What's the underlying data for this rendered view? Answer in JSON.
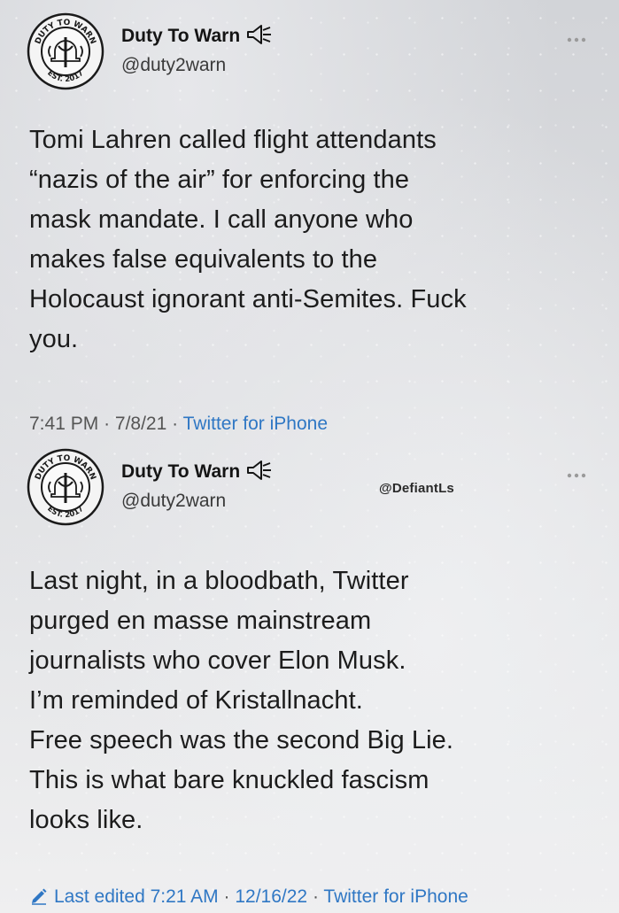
{
  "tweets": [
    {
      "author": {
        "display_name": "Duty To Warn",
        "handle": "@duty2warn",
        "logo_text_top": "DUTY TO WARN",
        "logo_text_bottom": "EST. 2017",
        "icons": [
          "logo-seal-icon",
          "speaker-icon",
          "more-options-icon"
        ]
      },
      "text_lines": [
        "Tomi Lahren called flight attendants",
        "“nazis of the air” for enforcing the",
        "mask mandate. I call anyone who",
        "makes false equivalents to the",
        "Holocaust ignorant anti-Semites. Fuck",
        "you."
      ],
      "meta": {
        "time": "7:41 PM",
        "date": "7/8/21",
        "separator": "·",
        "source": "Twitter for iPhone"
      }
    },
    {
      "author": {
        "display_name": "Duty To Warn",
        "handle": "@duty2warn",
        "logo_text_top": "DUTY TO WARN",
        "logo_text_bottom": "EST. 2017",
        "icons": [
          "logo-seal-icon",
          "speaker-icon",
          "more-options-icon"
        ]
      },
      "watermark": "@DefiantLs",
      "text_lines": [
        "Last night, in a bloodbath, Twitter",
        "purged en masse mainstream",
        "journalists who cover Elon Musk.",
        "I’m reminded of Kristallnacht.",
        "Free speech was the second Big Lie.",
        "This is what bare knuckled fascism",
        "looks like."
      ],
      "meta": {
        "edited_label": "Last edited",
        "time": "7:21 AM",
        "date": "12/16/22",
        "separator": "·",
        "source": "Twitter for iPhone",
        "icon": "pencil-icon"
      }
    }
  ],
  "colors": {
    "link": "#2f77c4",
    "text": "#1c1c1c",
    "meta": "#555555"
  }
}
